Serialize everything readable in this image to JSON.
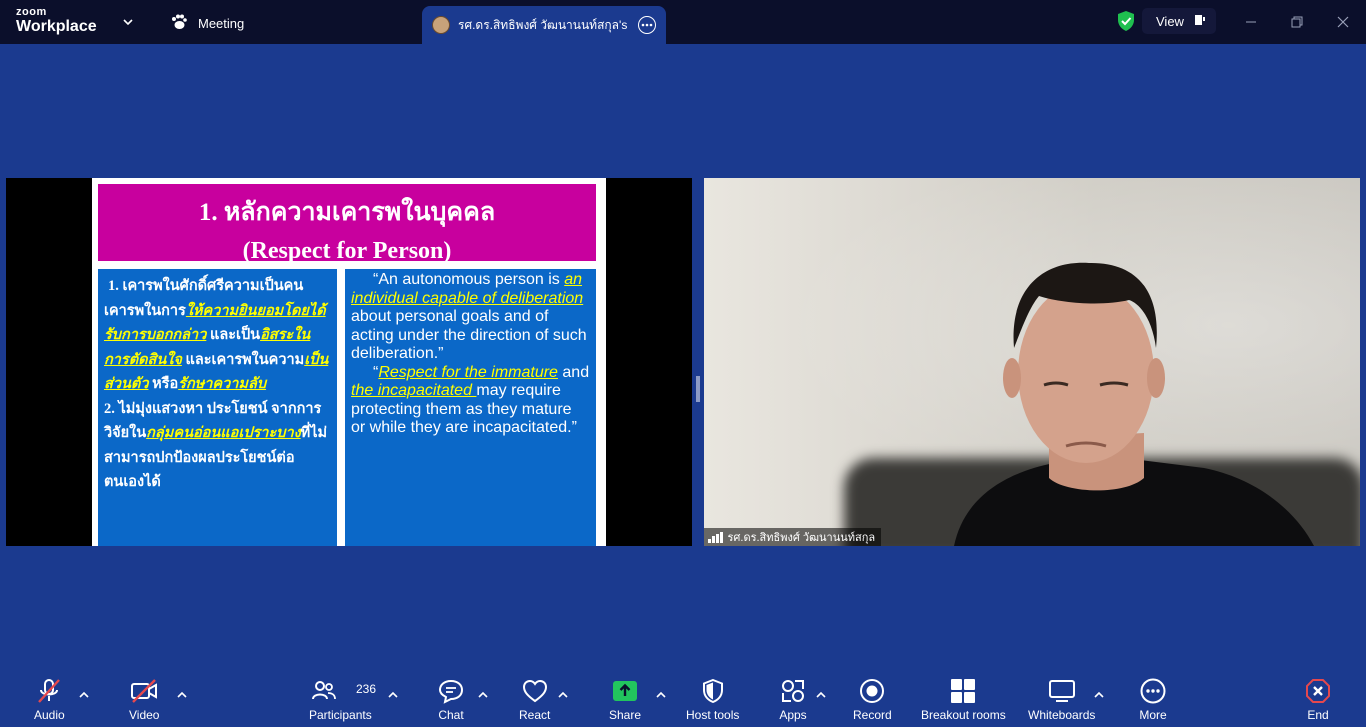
{
  "titlebar": {
    "logo_line1": "zoom",
    "logo_line2": "Workplace",
    "meeting_tab": "Meeting",
    "share_tab": "รศ.ดร.สิทธิพงศ์ วัฒนานนท์สกุล's scree",
    "view_label": "View"
  },
  "slide": {
    "title_line1": "1. หลักความเคารพในบุคคล",
    "title_line2": "(Respect for Person)",
    "left_panel": {
      "seg1": "1. เคารพในศักดิ์ศรีความเป็นคน เคารพในการ",
      "seg2": "ให้ความยินยอมโดยได้รับการบอกกล่าว",
      "seg3": " และเป็น",
      "seg4": "อิสระในการตัดสินใจ",
      "seg5": " และเคารพในความ",
      "seg6": "เป็นส่วนตัว",
      "seg7": " หรือ",
      "seg8": "รักษาความลับ",
      "seg9": "2. ไม่มุ่งแสวงหา ประโยชน์ จากการวิจัยใน",
      "seg10": "กลุ่มคนอ่อนแอเปราะบาง",
      "seg11": "ที่ไม่สามารถปกป้องผลประโยชน์ต่อตนเองได้"
    },
    "right_panel": {
      "p1_a": "“An autonomous person is ",
      "p1_hl": "an individual capable of deliberation ",
      "p1_b": "about personal goals and of acting under the direction of such deliberation.”",
      "p2_a": "“",
      "p2_hl1": "Respect for the immature",
      "p2_b": " and ",
      "p2_hl2": "the incapacitated ",
      "p2_c": "may require protecting them as they mature or while they are incapacitated.”"
    }
  },
  "video": {
    "participant_name": "รศ.ดร.สิทธิพงศ์ วัฒนานนท์สกุล"
  },
  "toolbar": {
    "audio": "Audio",
    "video": "Video",
    "participants": "Participants",
    "participants_count": "236",
    "chat": "Chat",
    "react": "React",
    "share": "Share",
    "host_tools": "Host tools",
    "apps": "Apps",
    "record": "Record",
    "breakout_rooms": "Breakout rooms",
    "whiteboards": "Whiteboards",
    "more": "More",
    "end": "End"
  },
  "colors": {
    "background": "#1b3a8f",
    "titlebar": "#0b0f2b",
    "slide_title": "#c8009e",
    "slide_panel": "#0b68c8",
    "highlight_text": "#ffff00",
    "share_green": "#22c55e",
    "end_red": "#e5484d",
    "security_green": "#1fbf4f"
  }
}
